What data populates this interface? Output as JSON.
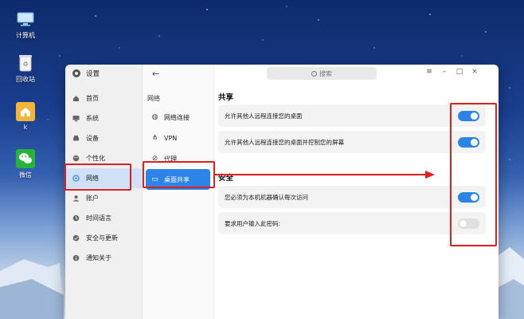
{
  "desktop": {
    "icons": [
      {
        "label": "计算机",
        "icon": "computer-icon"
      },
      {
        "label": "回收站",
        "icon": "trash-icon"
      },
      {
        "label": "k",
        "icon": "home-folder-icon"
      },
      {
        "label": "微信",
        "icon": "wechat-icon"
      }
    ]
  },
  "app": {
    "title": "设置",
    "search_placeholder": "搜索",
    "controls": [
      "≡",
      "–",
      "□",
      "×"
    ]
  },
  "sidebar": {
    "items": [
      {
        "label": "首页",
        "icon": "home-icon"
      },
      {
        "label": "系统",
        "icon": "system-icon"
      },
      {
        "label": "设备",
        "icon": "device-icon"
      },
      {
        "label": "个性化",
        "icon": "personalize-icon"
      },
      {
        "label": "网络",
        "icon": "network-icon",
        "active": true
      },
      {
        "label": "账户",
        "icon": "account-icon"
      },
      {
        "label": "时间语言",
        "icon": "clock-icon"
      },
      {
        "label": "安全与更新",
        "icon": "security-icon"
      },
      {
        "label": "通知关于",
        "icon": "info-icon"
      }
    ]
  },
  "network_panel": {
    "back": "←",
    "heading": "网络",
    "items": [
      {
        "label": "网络连接",
        "icon": "globe-icon"
      },
      {
        "label": "VPN",
        "icon": "vpn-icon"
      },
      {
        "label": "代理",
        "icon": "proxy-icon"
      },
      {
        "label": "桌面共享",
        "icon": "desktop-share-icon",
        "active": true
      }
    ]
  },
  "content": {
    "share": {
      "title": "共享",
      "options": [
        {
          "label": "允许其他人远程连接您的桌面",
          "enabled": true
        },
        {
          "label": "允许其他人远程连接您的桌面并控制您的屏幕",
          "enabled": true
        }
      ]
    },
    "security": {
      "title": "安全",
      "options": [
        {
          "label": "您必须为本机机器确认每次访问",
          "enabled": true
        },
        {
          "label": "要求用户输入此密码:",
          "enabled": false
        }
      ]
    }
  },
  "colors": {
    "accent": "#2b84e6",
    "annotation": "#e02020",
    "active_nav": "#cfe0f7"
  }
}
